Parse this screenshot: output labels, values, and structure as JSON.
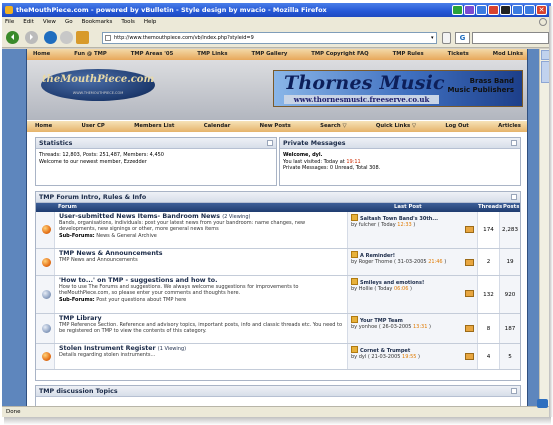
{
  "window": {
    "title": "theMouthPiece.com - powered by vBulletin - Style design by mvacio - Mozilla Firefox",
    "close_glyph": "✕"
  },
  "menubar": [
    "File",
    "Edit",
    "View",
    "Go",
    "Bookmarks",
    "Tools",
    "Help"
  ],
  "address": {
    "url": "http://www.themouthpiece.com/vb/index.php?styleid=9",
    "go_icon": "go-arrow-icon",
    "search_engine": "G"
  },
  "status": {
    "text": "Done"
  },
  "forum": {
    "top_nav": [
      "Home",
      "Fun @ TMP",
      "TMP Areas '05",
      "TMP Links",
      "TMP Gallery",
      "TMP Copyright FAQ",
      "TMP Rules",
      "Tickets",
      "Mod Links"
    ],
    "logo_text": "theMouthPiece.com",
    "logo_sub": "WWW.THEMOUTHPIECE.COM",
    "ad": {
      "title": "Thornes Music",
      "url": "www.thornesmusic.freeserve.co.uk",
      "line1": "Brass Band",
      "line2": "Music Publishers"
    },
    "main_nav": [
      "Home",
      "User CP",
      "Members List",
      "Calendar",
      "New Posts",
      "Search ▽",
      "Quick Links ▽",
      "Log Out",
      "Articles"
    ],
    "stats": {
      "title": "Statistics",
      "line1": "Threads: 12,803, Posts: 251,487, Members: 4,450",
      "line2": "Welcome to our newest member, Ezzedder"
    },
    "pms": {
      "title": "Private Messages",
      "welcome": "Welcome, dyl.",
      "visited_pre": "You last visited: Today at ",
      "visited_time": "19:11",
      "pm_line": "Private Messages: 0 Unread, Total 308."
    },
    "section1": {
      "title": "TMP Forum Intro, Rules & Info",
      "col_forum": "Forum",
      "col_last": "Last Post",
      "col_threads": "Threads",
      "col_posts": "Posts",
      "rows": [
        {
          "name": "User-submitted News Items- Bandroom News",
          "viewing": "(2 Viewing)",
          "desc": "Bands, organisations, individuals: post your latest news from your bandroom: name changes, new developments, new signings or other, more general news items",
          "subs_label": "Sub-Forums:",
          "subs": "News & General Archive",
          "last_title": "Saltash Town Band's 30th...",
          "last_by": "by fulcher",
          "last_date": "( Today ",
          "last_time": "12:33",
          "last_end": " )",
          "threads": "174",
          "posts": "2,283"
        },
        {
          "name": "TMP News & Announcements",
          "viewing": "",
          "desc": "TMP News and Announcements",
          "subs_label": "",
          "subs": "",
          "last_title": "A Reminder!",
          "last_by": "by Roger Thorne",
          "last_date": "( 31-03-2005 ",
          "last_time": "21:46",
          "last_end": " )",
          "threads": "2",
          "posts": "19"
        },
        {
          "name": "'How to...' on TMP - suggestions and how to.",
          "viewing": "",
          "desc": "How to use The Forums and suggestions. We always welcome suggestions for improvements to theMouthPiece.com, so please enter your comments and thoughts here.",
          "subs_label": "Sub-Forums:",
          "subs": "Post your questions about TMP here",
          "last_title": "Smileys and emotions!",
          "last_by": "by Hollie",
          "last_date": "( Today ",
          "last_time": "06:06",
          "last_end": " )",
          "threads": "132",
          "posts": "920"
        },
        {
          "name": "TMP Library",
          "viewing": "",
          "desc": "TMP Reference Section. Reference and advisory topics, important posts, info and classic threads etc. You need to be registered on TMP to view the contents of this category.",
          "subs_label": "",
          "subs": "",
          "last_title": "Your TMP Team",
          "last_by": "by yonhoe",
          "last_date": "( 26-03-2005 ",
          "last_time": "13:31",
          "last_end": " )",
          "threads": "8",
          "posts": "187"
        },
        {
          "name": "Stolen Instrument Register",
          "viewing": "(1 Viewing)",
          "desc": "Details regarding stolen instruments...",
          "subs_label": "",
          "subs": "",
          "last_title": "Cornet & Trumpet",
          "last_by": "by dyl",
          "last_date": "( 21-03-2005 ",
          "last_time": "19:55",
          "last_end": " )",
          "threads": "4",
          "posts": "5"
        }
      ]
    },
    "section2": {
      "title": "TMP discussion Topics"
    }
  }
}
